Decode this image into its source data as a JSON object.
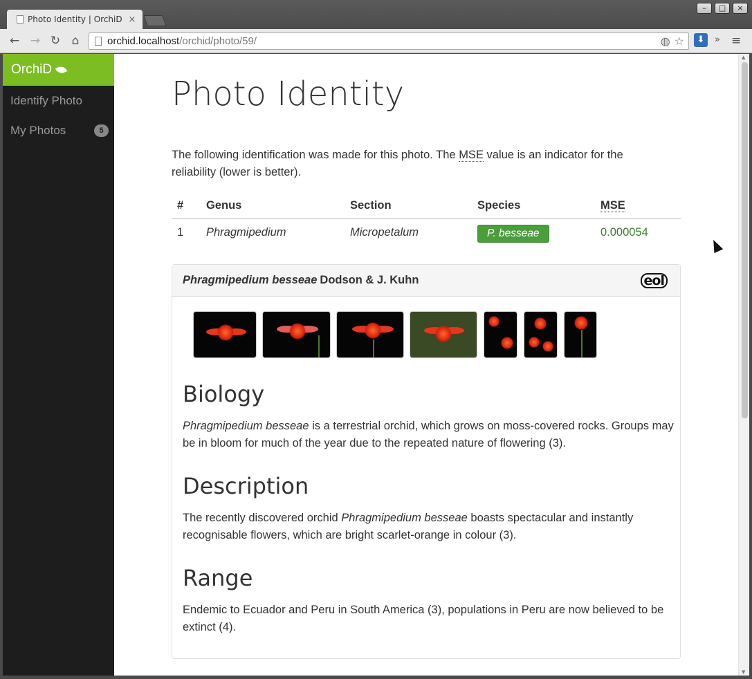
{
  "browser": {
    "tab_title": "Photo Identity | OrchiD",
    "tab_close": "×",
    "url_host": "orchid.localhost",
    "url_path": "/orchid/photo/59/",
    "window_buttons": [
      "–",
      "□",
      "×"
    ]
  },
  "sidebar": {
    "brand": "OrchiD",
    "items": [
      {
        "label": "Identify Photo",
        "badge": ""
      },
      {
        "label": "My Photos",
        "badge": "5"
      }
    ]
  },
  "page": {
    "title": "Photo Identity",
    "intro_before": "The following identification was made for this photo. The ",
    "intro_abbr": "MSE",
    "intro_after": " value is an indicator for the reliability (lower is better)."
  },
  "table": {
    "headers": [
      "#",
      "Genus",
      "Section",
      "Species",
      "MSE"
    ],
    "rows": [
      {
        "num": "1",
        "genus": "Phragmipedium",
        "section": "Micropetalum",
        "species": "P. besseae",
        "mse": "0.000054"
      }
    ]
  },
  "panel": {
    "scientific_name": "Phragmipedium besseae",
    "authority": "Dodson & J. Kuhn",
    "logo_text": "eol",
    "photo_count": 7,
    "sections": [
      {
        "heading": "Biology",
        "text_em": "Phragmipedium besseae",
        "text_after": " is a terrestrial orchid, which grows on moss-covered rocks. Groups may be in bloom for much of the year due to the repeated nature of flowering (3)."
      },
      {
        "heading": "Description",
        "text_before": "The recently discovered orchid ",
        "text_em": "Phragmipedium besseae",
        "text_after": " boasts spectacular and instantly recognisable flowers, which are bright scarlet-orange in colour (3)."
      },
      {
        "heading": "Range",
        "text_before": "Endemic to Ecuador and Peru in South America (3), populations in Peru are now believed to be extinct (4)."
      }
    ]
  },
  "colors": {
    "brand_green": "#7cbd22",
    "sidebar_bg": "#1d1d1d",
    "species_button": "#4a9e3c",
    "mse_text": "#3c7a30"
  }
}
